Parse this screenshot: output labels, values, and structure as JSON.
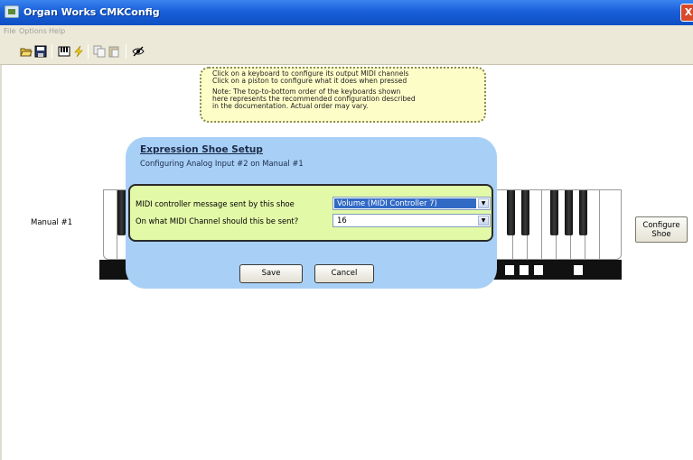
{
  "window": {
    "title": "Organ Works CMKConfig",
    "close_label": "X"
  },
  "menu": {
    "items": [
      "File",
      "Options",
      "Help"
    ]
  },
  "toolbar": {
    "icons": [
      "open-icon",
      "save-icon",
      "keyboard-icon",
      "lightning-icon",
      "copy-icon",
      "paste-icon",
      "eye-icon"
    ]
  },
  "note": {
    "lines": [
      "Click on a keyboard to configure its output MIDI channels",
      "Click on a piston to configure what it does when pressed",
      "Note: The top-to-bottom order of the keyboards shown",
      "here represents the recommended configuration described",
      "in the documentation.  Actual order may vary."
    ]
  },
  "manual": {
    "label": "Manual #1"
  },
  "configure_shoe": {
    "label_line1": "Configure",
    "label_line2": "Shoe"
  },
  "dialog": {
    "title": "Expression Shoe Setup",
    "subtitle": "Configuring Analog Input #2 on Manual #1",
    "controller_label": "MIDI controller message sent by this shoe",
    "controller_value": "Volume (MIDI Controller 7)",
    "channel_label": "On what MIDI Channel should this be sent?",
    "channel_value": "16",
    "save_label": "Save",
    "cancel_label": "Cancel"
  },
  "colors": {
    "titlebar": "#1a5fd8",
    "dialog_bg": "#a8d0f6",
    "panel_bg": "#e2f9a8",
    "note_bg": "#fdfdc8",
    "selection": "#316ac5"
  }
}
